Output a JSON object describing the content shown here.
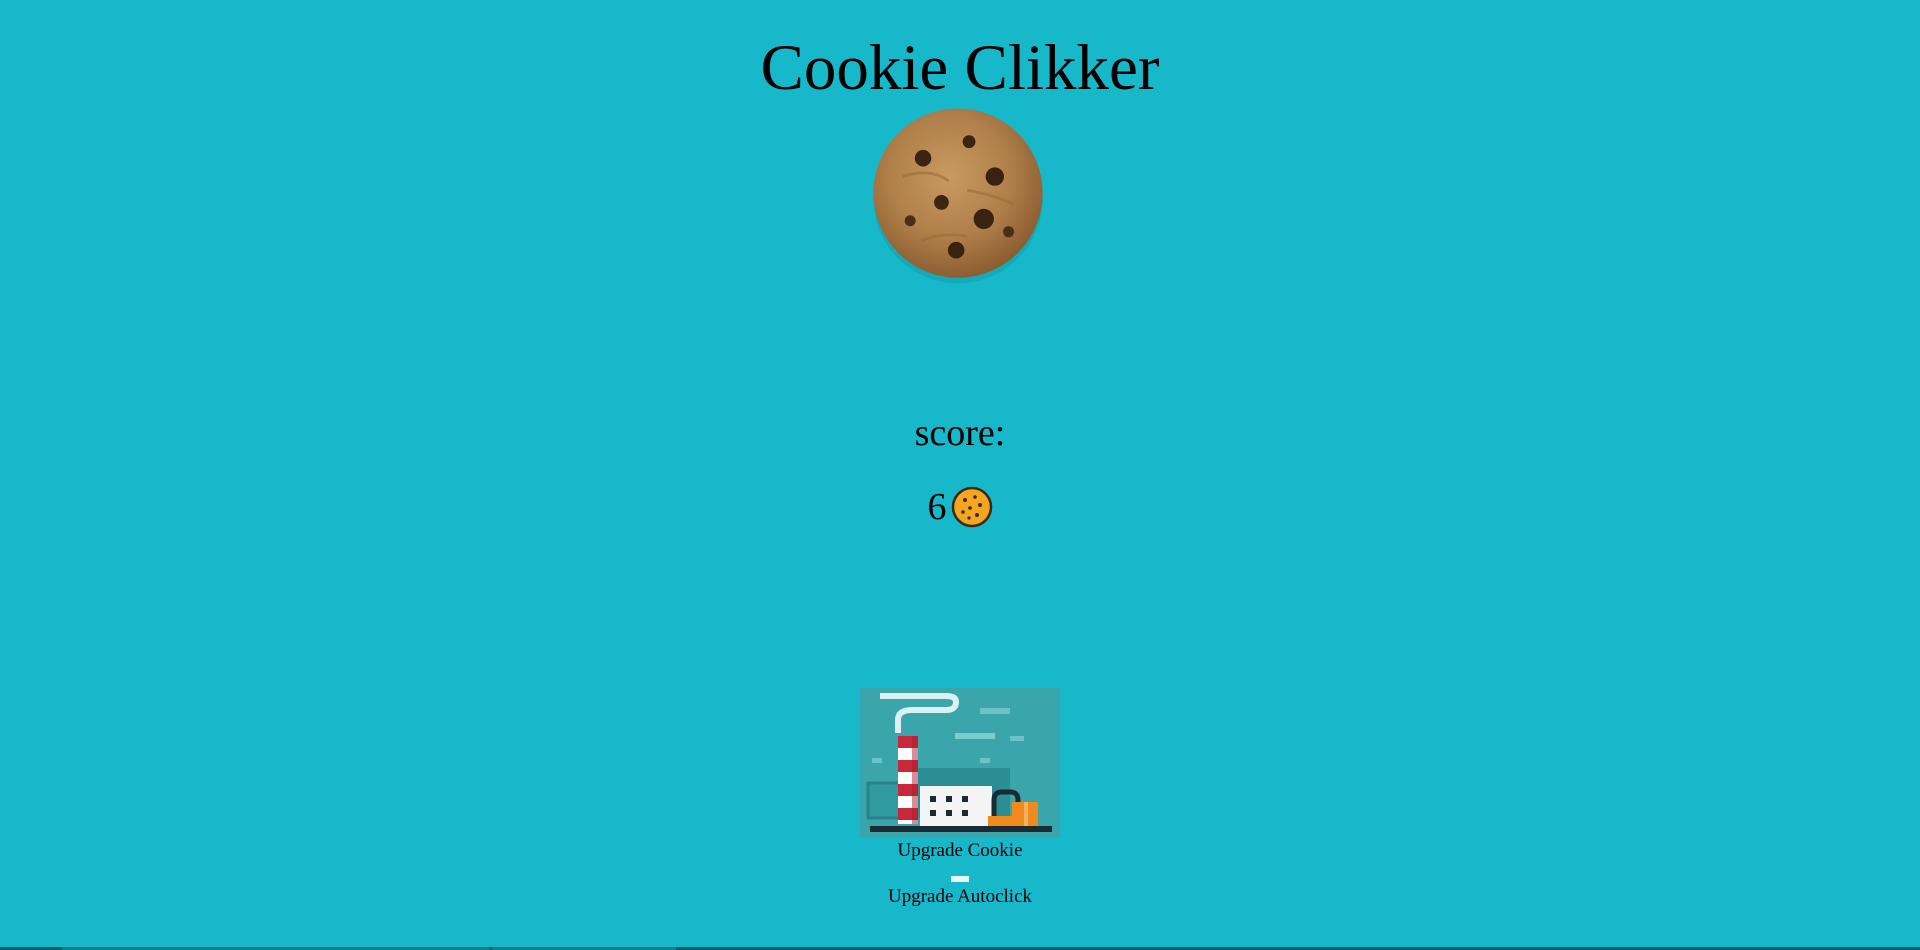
{
  "game": {
    "title": "Cookie Clikker",
    "score_label": "score:",
    "score_value": "6"
  },
  "upgrades": {
    "cookie_label": "Upgrade Cookie",
    "autoclick_label": "Upgrade Autoclick"
  },
  "colors": {
    "background": "#16b8c9",
    "coin_fill": "#f4a623"
  },
  "icons": {
    "cookie": "cookie-image",
    "coin": "cookie-coin-icon",
    "factory": "factory-image"
  }
}
